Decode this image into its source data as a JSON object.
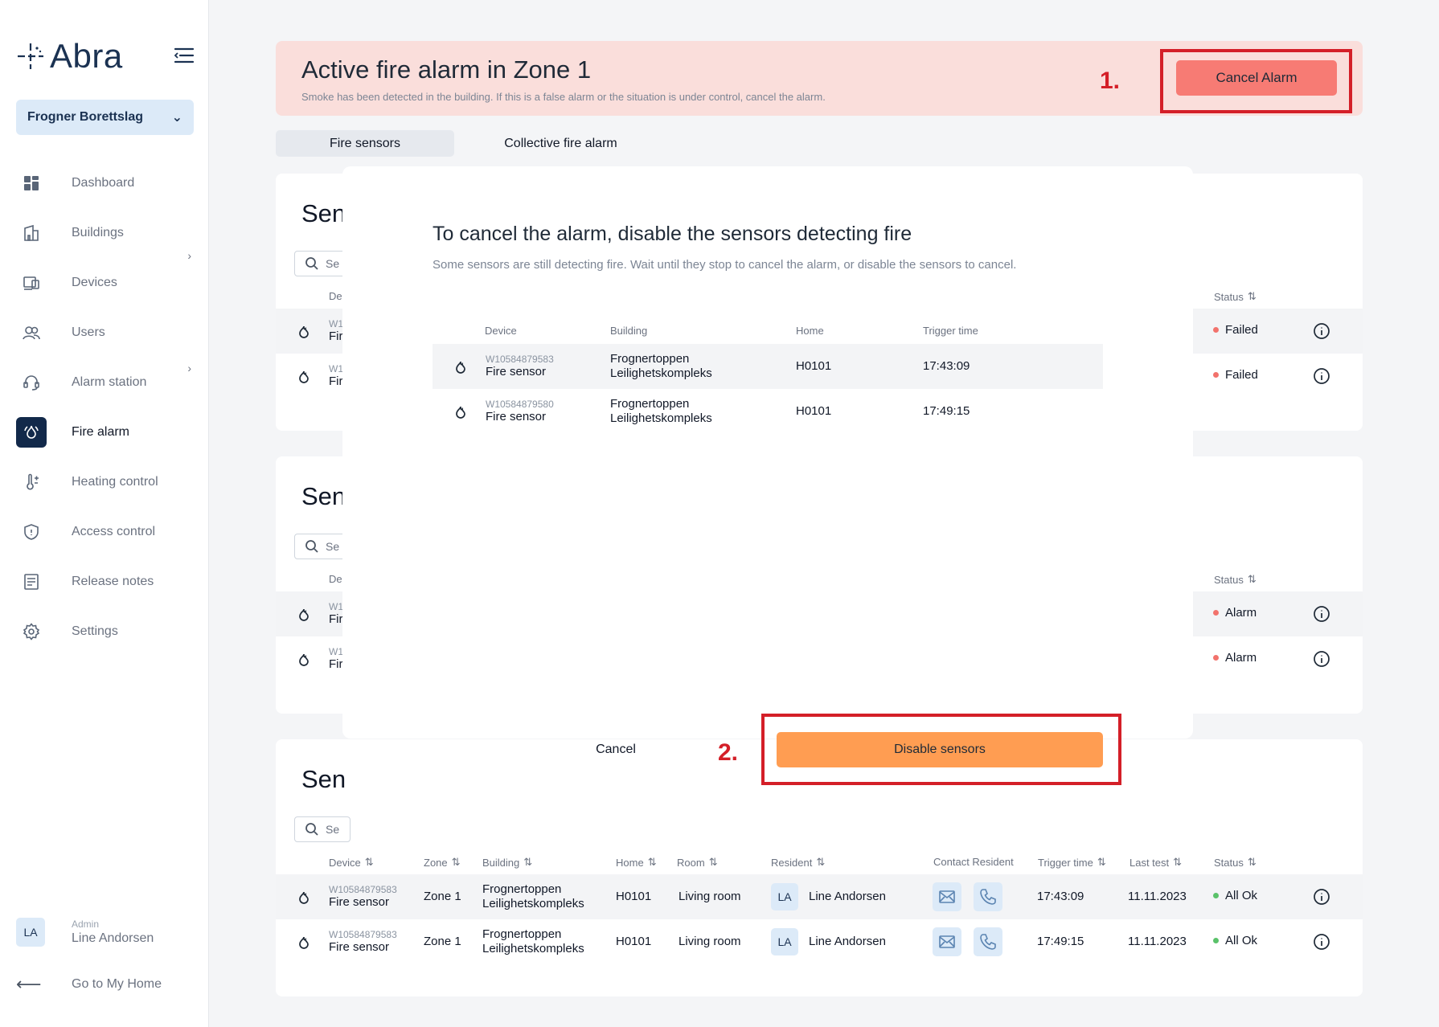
{
  "brand": {
    "name": "Abra"
  },
  "org_select": {
    "value": "Frogner Borettslag"
  },
  "nav": {
    "items": [
      {
        "label": "Dashboard",
        "icon": "dashboard-icon"
      },
      {
        "label": "Buildings",
        "icon": "building-icon"
      },
      {
        "label": "Devices",
        "icon": "devices-icon"
      },
      {
        "label": "Users",
        "icon": "users-icon"
      },
      {
        "label": "Alarm station",
        "icon": "headset-icon"
      },
      {
        "label": "Fire alarm",
        "icon": "fire-alarm-icon"
      },
      {
        "label": "Heating control",
        "icon": "thermometer-icon"
      },
      {
        "label": "Access control",
        "icon": "shield-icon"
      },
      {
        "label": "Release notes",
        "icon": "notes-icon"
      },
      {
        "label": "Settings",
        "icon": "gear-icon"
      }
    ]
  },
  "user": {
    "initials": "LA",
    "role": "Admin",
    "name": "Line Andorsen"
  },
  "go_home": {
    "label": "Go to My Home"
  },
  "banner": {
    "title": "Active fire alarm in Zone 1",
    "subtitle": "Smoke has been detected in the building. If this is a false alarm or the situation is under control, cancel the alarm.",
    "cancel_label": "Cancel Alarm"
  },
  "annotations": {
    "step1": "1.",
    "step2": "2."
  },
  "tabs": [
    {
      "label": "Fire sensors"
    },
    {
      "label": "Collective fire alarm"
    }
  ],
  "cards": {
    "partial_title": "Sen",
    "search_partial": "Se",
    "header_device_partial": "De",
    "status_header": "Status",
    "id_partial": "W1",
    "name_partial": "Fir",
    "card1_statuses": [
      "Failed",
      "Failed"
    ],
    "card2_statuses": [
      "Alarm",
      "Alarm"
    ]
  },
  "table3": {
    "headers": {
      "device": "Device",
      "zone": "Zone",
      "building": "Building",
      "home": "Home",
      "room": "Room",
      "resident": "Resident",
      "contact": "Contact Resident",
      "trigger": "Trigger time",
      "last_test": "Last test",
      "status": "Status"
    },
    "rows": [
      {
        "id": "W10584879583",
        "name": "Fire sensor",
        "zone": "Zone 1",
        "building_1": "Frognertoppen",
        "building_2": "Leilighetskompleks",
        "home": "H0101",
        "room": "Living room",
        "initials": "LA",
        "resident": "Line Andorsen",
        "trigger": "17:43:09",
        "last_test": "11.11.2023",
        "status": "All Ok"
      },
      {
        "id": "W10584879583",
        "name": "Fire sensor",
        "zone": "Zone 1",
        "building_1": "Frognertoppen",
        "building_2": "Leilighetskompleks",
        "home": "H0101",
        "room": "Living room",
        "initials": "LA",
        "resident": "Line Andorsen",
        "trigger": "17:49:15",
        "last_test": "11.11.2023",
        "status": "All Ok"
      }
    ]
  },
  "modal": {
    "title": "To cancel the alarm, disable the sensors detecting fire",
    "subtitle": "Some sensors are still detecting fire. Wait until they stop to cancel the alarm, or disable the sensors to cancel.",
    "headers": {
      "device": "Device",
      "building": "Building",
      "home": "Home",
      "trigger": "Trigger time"
    },
    "rows": [
      {
        "id": "W10584879583",
        "name": "Fire sensor",
        "building_1": "Frognertoppen",
        "building_2": "Leilighetskompleks",
        "home": "H0101",
        "trigger": "17:43:09"
      },
      {
        "id": "W10584879580",
        "name": "Fire sensor",
        "building_1": "Frognertoppen",
        "building_2": "Leilighetskompleks",
        "home": "H0101",
        "trigger": "17:49:15"
      }
    ],
    "cancel_label": "Cancel",
    "disable_label": "Disable sensors"
  },
  "colors": {
    "brand_navy": "#12294a",
    "banner_bg": "#fadedb",
    "cancel_alarm_bg": "#f77b74",
    "disable_bg": "#ff9d52",
    "annotation_red": "#d41f28",
    "status_red": "#f2726c",
    "status_green": "#5ac26a"
  }
}
